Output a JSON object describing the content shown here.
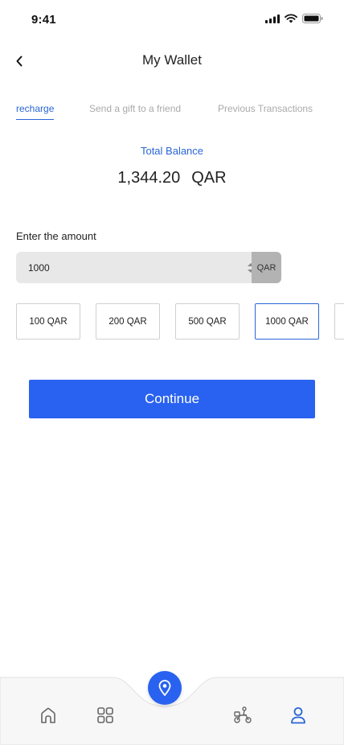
{
  "status_bar": {
    "time": "9:41"
  },
  "header": {
    "title": "My Wallet"
  },
  "tabs": [
    {
      "label": "recharge",
      "active": true
    },
    {
      "label": "Send a gift to a friend",
      "active": false
    },
    {
      "label": "Previous Transactions",
      "active": false
    }
  ],
  "balance": {
    "label": "Total Balance",
    "amount": "1,344.20",
    "currency": "QAR"
  },
  "amount_input": {
    "label": "Enter the amount",
    "value": "1000",
    "currency": "QAR"
  },
  "quick_amounts": [
    {
      "label": "100 QAR",
      "selected": false
    },
    {
      "label": "200 QAR",
      "selected": false
    },
    {
      "label": "500 QAR",
      "selected": false
    },
    {
      "label": "1000 QAR",
      "selected": true
    },
    {
      "label": "",
      "selected": false
    }
  ],
  "continue_label": "Continue",
  "bottom_nav": {
    "items": [
      {
        "icon": "home-icon",
        "active": false
      },
      {
        "icon": "grid-icon",
        "active": false
      },
      {
        "icon": "location-pin-icon",
        "active": false
      },
      {
        "icon": "delivery-scooter-icon",
        "active": false
      },
      {
        "icon": "user-icon",
        "active": true
      }
    ]
  },
  "colors": {
    "accent": "#2a66d6",
    "button": "#2962f0",
    "input_bg": "#e8e8e8",
    "addon_bg": "#b3b3b3"
  }
}
